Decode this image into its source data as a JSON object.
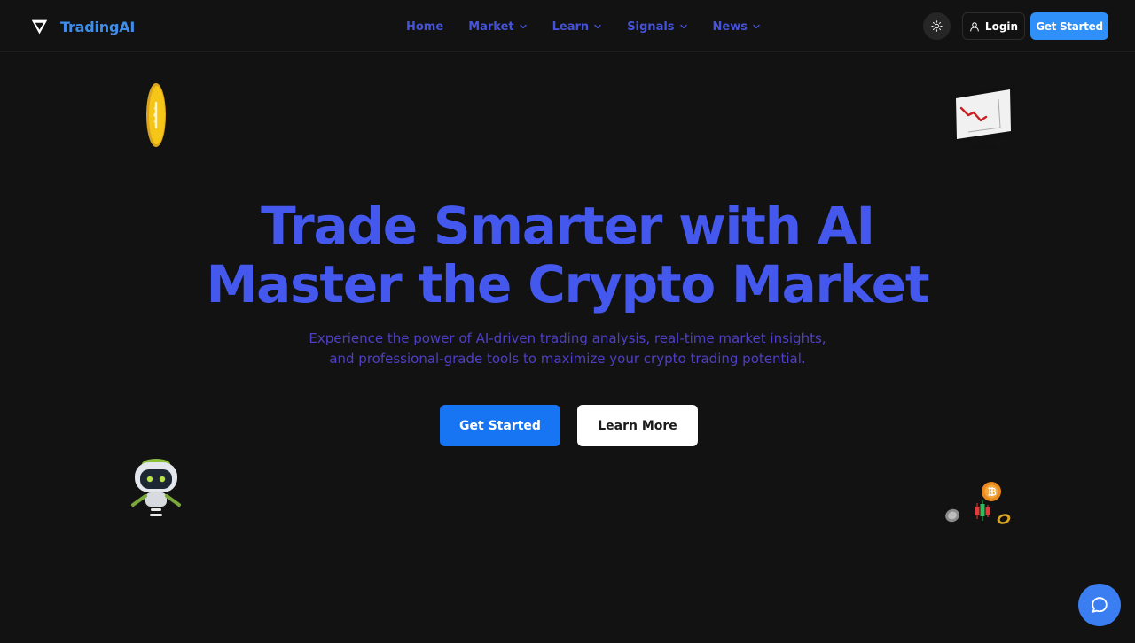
{
  "brand": {
    "name": "TradingAI",
    "logo_icon": "funnel-logo-icon"
  },
  "nav": {
    "items": [
      {
        "label": "Home",
        "has_dropdown": false
      },
      {
        "label": "Market",
        "has_dropdown": true
      },
      {
        "label": "Learn",
        "has_dropdown": true
      },
      {
        "label": "Signals",
        "has_dropdown": true
      },
      {
        "label": "News",
        "has_dropdown": true
      }
    ]
  },
  "header": {
    "theme_toggle_icon": "sun-icon",
    "login_label": "Login",
    "login_icon": "user-icon",
    "cta_label": "Get Started"
  },
  "hero": {
    "title_line1": "Trade Smarter with AI",
    "title_line2": "Master the Crypto Market",
    "subtitle_line1": "Experience the power of AI-driven trading analysis, real-time market insights,",
    "subtitle_line2": "and professional-grade tools to maximize your crypto trading potential.",
    "primary_button": "Get Started",
    "secondary_button": "Learn More"
  },
  "decorations": [
    "gold-coin-icon",
    "declining-chart-monitor-icon",
    "robot-mascot-icon",
    "crypto-coins-candlestick-icon"
  ],
  "chat": {
    "icon": "chat-bubble-icon"
  },
  "colors": {
    "background": "#121212",
    "brand": "#3f8de8",
    "nav_link": "#4652d8",
    "hero_title": "#4458ee",
    "hero_subtitle": "#4f3fc4",
    "primary_button": "#1774f2",
    "header_cta": "#2e90f8",
    "chat_button": "#3b7ef2"
  }
}
